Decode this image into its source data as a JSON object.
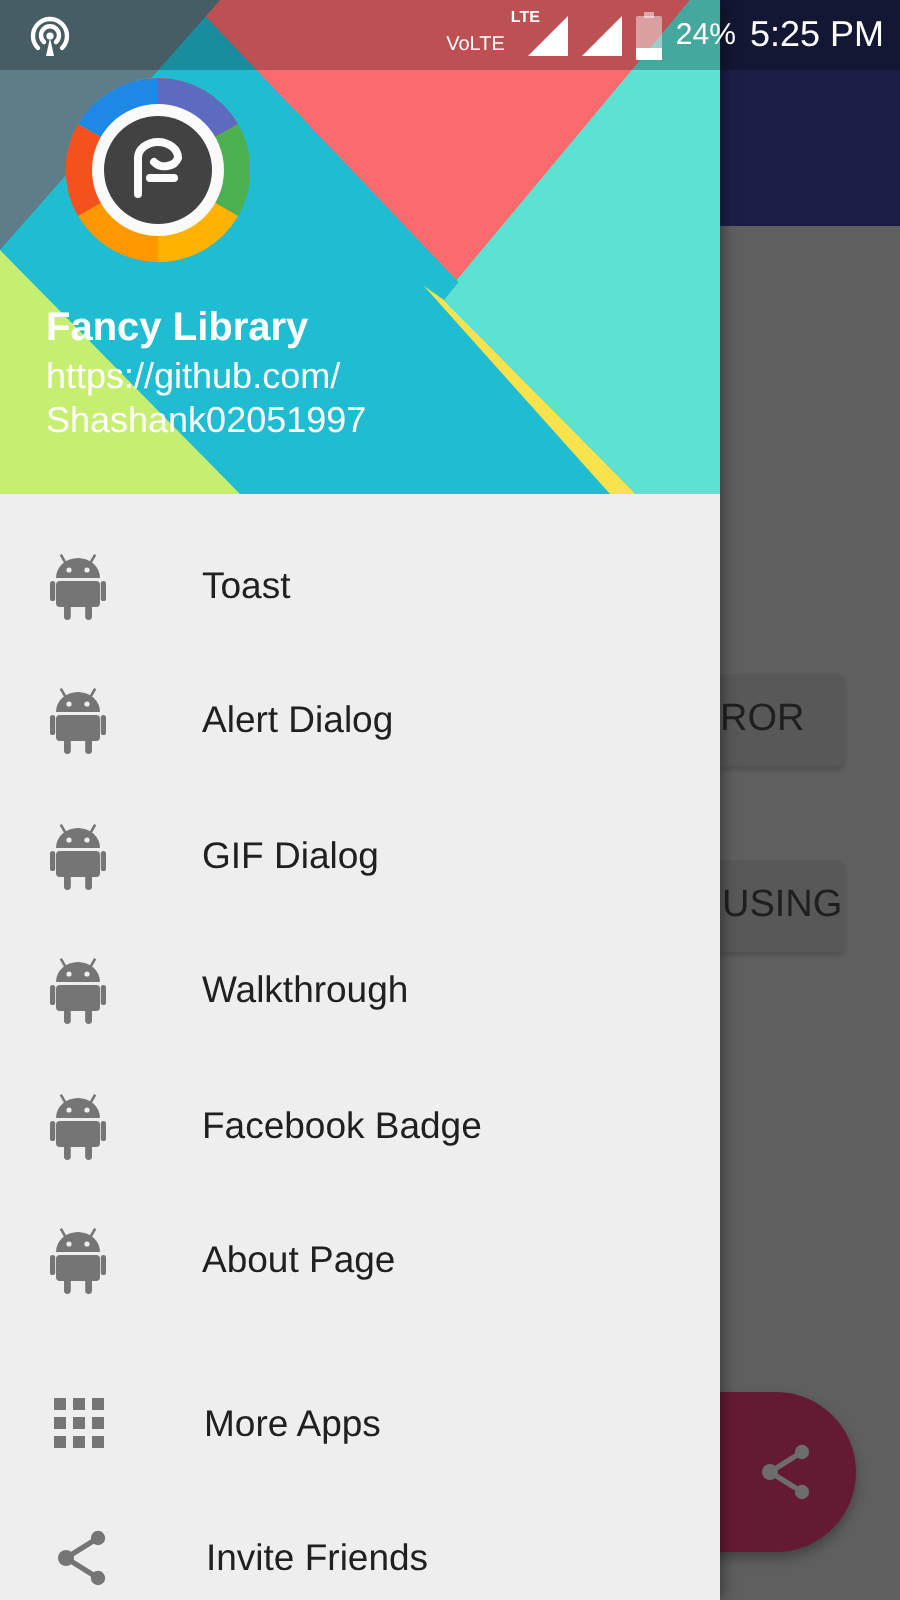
{
  "status_bar": {
    "network_label": "VoLTE",
    "lte_label": "LTE",
    "battery": "24%",
    "time": "5:25 PM"
  },
  "drawer": {
    "header": {
      "title": "Fancy Library",
      "link_lines": [
        "https://github.com/",
        "Shashank02051997"
      ]
    },
    "items": [
      {
        "label": "Toast",
        "kind": "android"
      },
      {
        "label": "Alert Dialog",
        "kind": "android"
      },
      {
        "label": "GIF Dialog",
        "kind": "android"
      },
      {
        "label": "Walkthrough",
        "kind": "android"
      },
      {
        "label": "Facebook Badge",
        "kind": "android"
      },
      {
        "label": "About Page",
        "kind": "android"
      }
    ],
    "extra_items": [
      {
        "label": "More Apps",
        "kind": "apps"
      },
      {
        "label": "Invite Friends",
        "kind": "share"
      }
    ]
  },
  "background_app": {
    "buttons": [
      "ROR",
      "USING"
    ]
  }
}
